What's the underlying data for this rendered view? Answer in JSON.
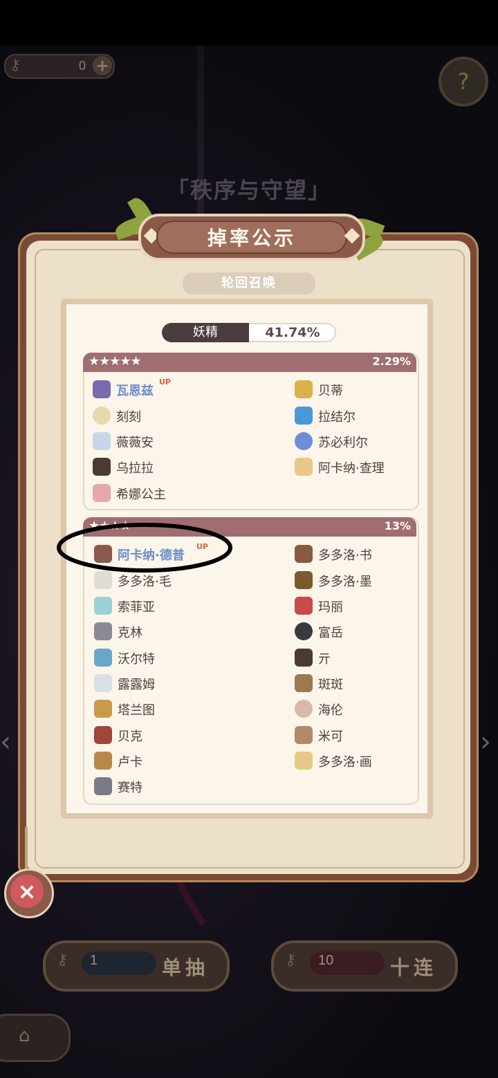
{
  "header": {
    "key_count": "0",
    "plus_icon": "+",
    "help_icon": "?",
    "banner_title": "「秩序与守望」"
  },
  "dialog": {
    "title": "掉率公示",
    "subtitle": "轮回召唤",
    "category": {
      "name": "妖精",
      "rate": "41.74%"
    },
    "groups": [
      {
        "stars": "★★★★★",
        "rate": "2.29%",
        "items": [
          {
            "name": "瓦恩兹",
            "up": "UP"
          },
          {
            "name": "贝蒂"
          },
          {
            "name": "刻刻"
          },
          {
            "name": "拉结尔"
          },
          {
            "name": "薇薇安"
          },
          {
            "name": "苏必利尔"
          },
          {
            "name": "乌拉拉"
          },
          {
            "name": "阿卡纳·查理"
          },
          {
            "name": "希娜公主"
          }
        ]
      },
      {
        "stars": "★★★★",
        "rate": "13%",
        "items": [
          {
            "name": "阿卡纳·德普",
            "up": "UP"
          },
          {
            "name": "多多洛·书"
          },
          {
            "name": "多多洛·毛"
          },
          {
            "name": "多多洛·墨"
          },
          {
            "name": "索菲亚"
          },
          {
            "name": "玛丽"
          },
          {
            "name": "克林"
          },
          {
            "name": "富岳"
          },
          {
            "name": "沃尔特"
          },
          {
            "name": "亓"
          },
          {
            "name": "露露姆"
          },
          {
            "name": "斑斑"
          },
          {
            "name": "塔兰图"
          },
          {
            "name": "海伦"
          },
          {
            "name": "贝克"
          },
          {
            "name": "米可"
          },
          {
            "name": "卢卡"
          },
          {
            "name": "多多洛·画"
          },
          {
            "name": "赛特"
          }
        ]
      }
    ],
    "close_icon": "×"
  },
  "footer": {
    "single_count": "1",
    "single_label": "单抽",
    "ten_count": "10",
    "ten_label": "十连",
    "home_icon": "⌂"
  },
  "colors": {
    "up_name": "#6b8ec9",
    "group_bar": "#a06d70",
    "panel_border": "#7a4a33",
    "parchment": "#ede0c9"
  }
}
